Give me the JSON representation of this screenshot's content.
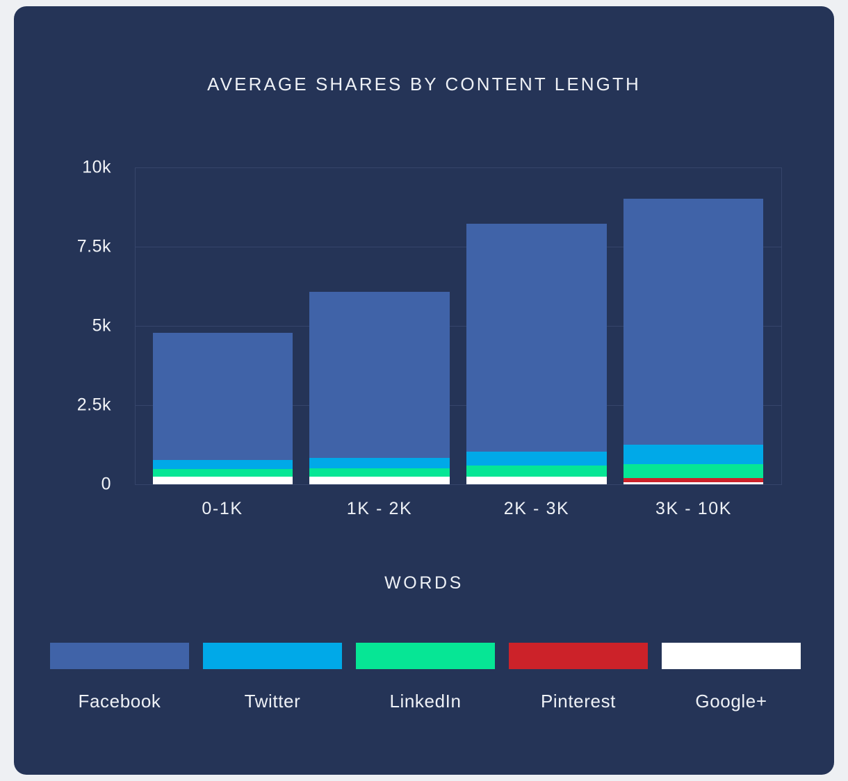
{
  "card": {
    "background": "#253457",
    "grid_color": "#36456b"
  },
  "chart_data": {
    "type": "bar",
    "subtype": "stacked-bar",
    "title": "AVERAGE SHARES BY CONTENT LENGTH",
    "xlabel": "WORDS",
    "ylabel": "",
    "categories": [
      "0-1K",
      "1K - 2K",
      "2K - 3K",
      "3K - 10K"
    ],
    "ylim": [
      0,
      10000
    ],
    "yticks": [
      0,
      2500,
      5000,
      7500,
      10000
    ],
    "ytick_labels": [
      "0",
      "2.5k",
      "5k",
      "7.5k",
      "10k"
    ],
    "grid": true,
    "legend_position": "bottom",
    "series": [
      {
        "name": "Facebook",
        "color": "#4063a8",
        "values": [
          4000,
          5250,
          7200,
          7750
        ]
      },
      {
        "name": "Twitter",
        "color": "#00a9e8",
        "values": [
          290,
          330,
          430,
          620
        ]
      },
      {
        "name": "LinkedIn",
        "color": "#06e695",
        "values": [
          240,
          260,
          350,
          440
        ]
      },
      {
        "name": "Pinterest",
        "color": "#cc2229",
        "values": [
          0,
          0,
          0,
          130
        ]
      },
      {
        "name": "Google+",
        "color": "#ffffff",
        "values": [
          240,
          240,
          250,
          70
        ]
      }
    ],
    "totals": [
      4770,
      6080,
      8230,
      9010
    ]
  }
}
